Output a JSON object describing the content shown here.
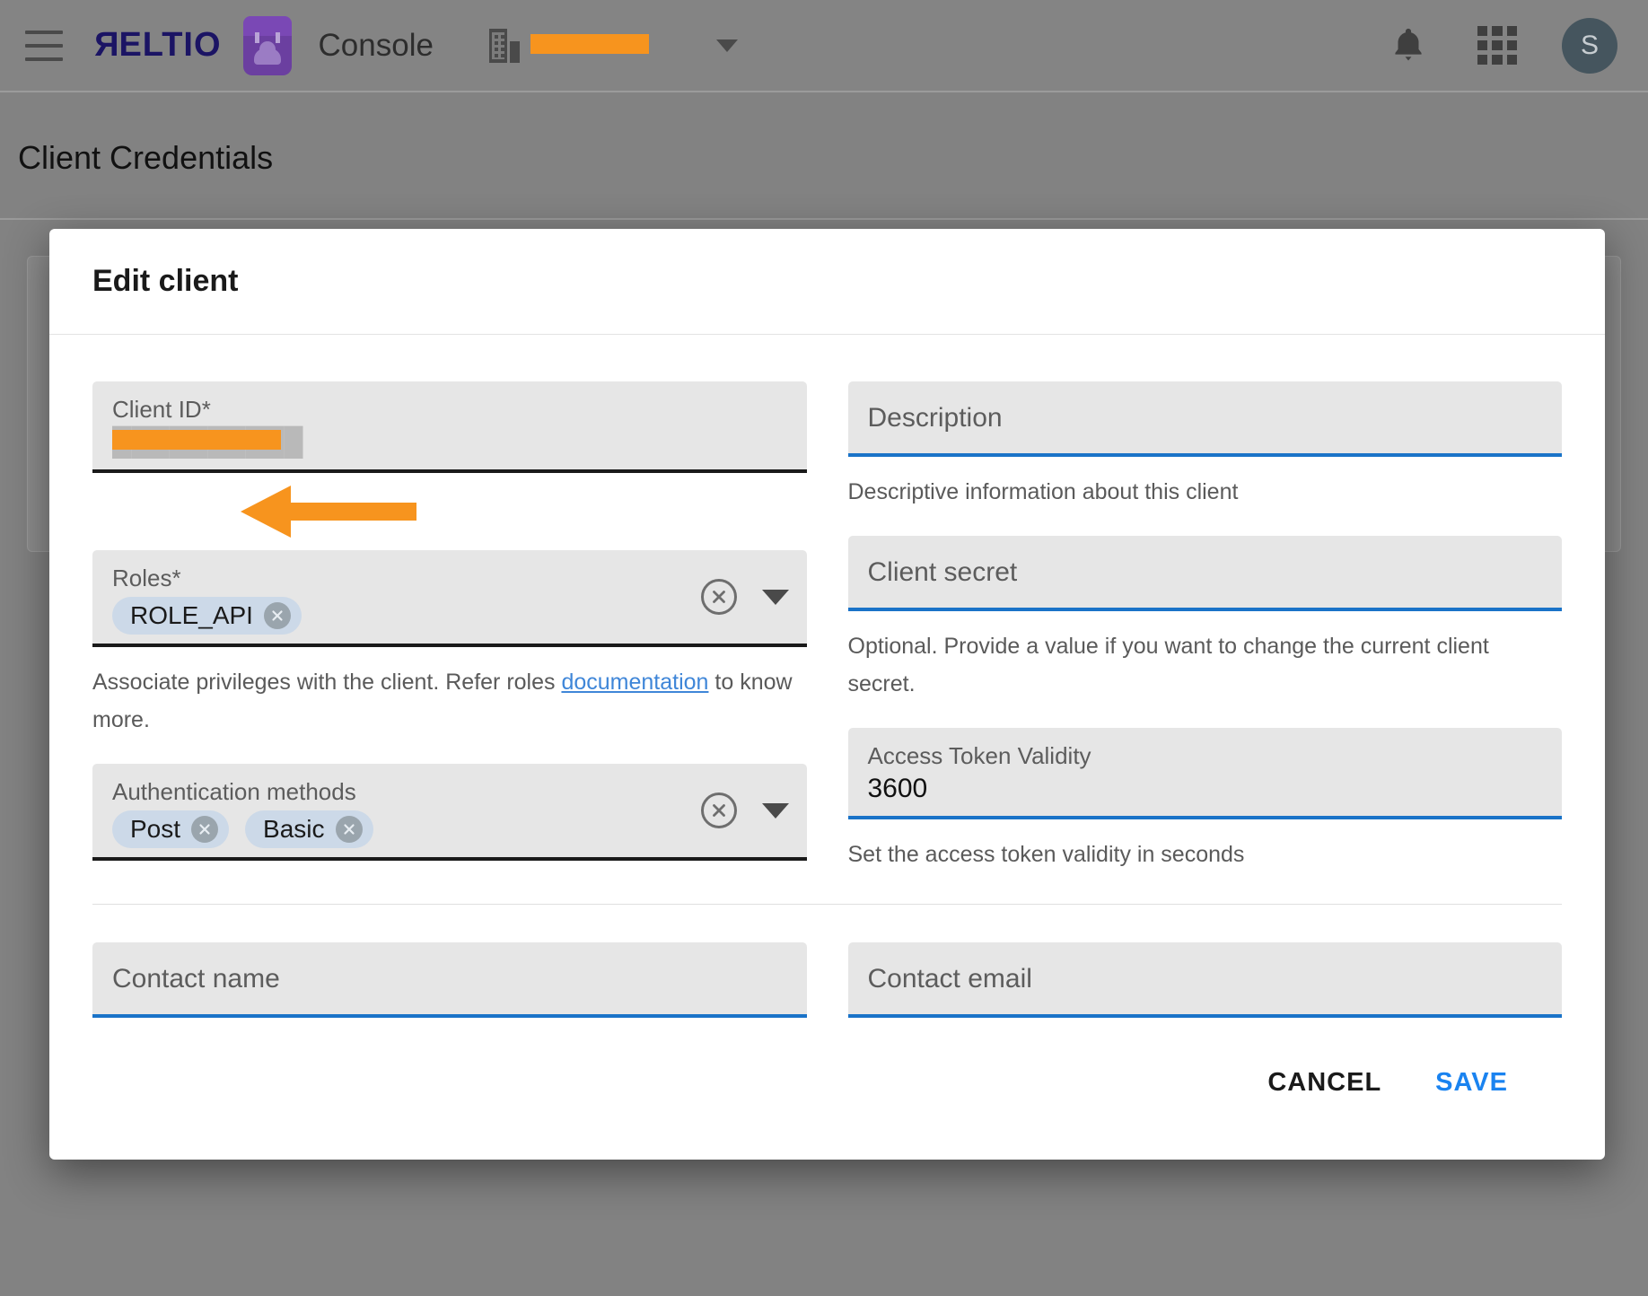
{
  "appbar": {
    "menu_icon": "hamburger-menu-icon",
    "brand": "RELTIO",
    "bag_icon": "briefcase-cloud-icon",
    "product": "Console",
    "tenant_icon": "building-icon",
    "tenant_name": "████████",
    "tenant_caret": "chevron-down-icon",
    "bell_icon": "notifications-bell-icon",
    "apps_icon": "apps-grid-icon",
    "avatar_initial": "S"
  },
  "page": {
    "title": "Client Credentials"
  },
  "modal": {
    "title": "Edit client",
    "fields": {
      "client_id": {
        "label": "Client ID*",
        "value": "██████████",
        "redacted": true
      },
      "description": {
        "placeholder": "Description",
        "value": "",
        "helper": "Descriptive information about this client"
      },
      "roles": {
        "label": "Roles*",
        "chips": [
          "ROLE_API"
        ],
        "helper_prefix": "Associate privileges with the client. Refer roles ",
        "helper_link": "documentation",
        "helper_suffix": " to know more.",
        "clear_icon": "clear-circle-x-icon",
        "dropdown_icon": "dropdown-triangle-icon"
      },
      "client_secret": {
        "placeholder": "Client secret",
        "value": "",
        "helper": "Optional. Provide a value if you want to change the current client secret."
      },
      "auth_methods": {
        "label": "Authentication methods",
        "chips": [
          "Post",
          "Basic"
        ],
        "clear_icon": "clear-circle-x-icon",
        "dropdown_icon": "dropdown-triangle-icon"
      },
      "access_token_validity": {
        "label": "Access Token Validity",
        "value": "3600",
        "helper": "Set the access token validity in seconds"
      },
      "contact_name": {
        "placeholder": "Contact name",
        "value": ""
      },
      "contact_email": {
        "placeholder": "Contact email",
        "value": ""
      }
    },
    "buttons": {
      "cancel": "CANCEL",
      "save": "SAVE"
    }
  },
  "annotation": {
    "arrow": "orange-left-arrow-annotation",
    "arrow_color": "#F7941E",
    "target": "roles-chip-role-api"
  },
  "colors": {
    "accent_blue": "#1a73c8",
    "save_blue": "#1a83f0",
    "link_blue": "#3f86d8",
    "annotation_orange": "#F7941E",
    "brand_navy": "#1b1464",
    "field_bg": "#e6e6e6",
    "chip_bg": "#ccd9e8",
    "page_bg": "#828282"
  }
}
